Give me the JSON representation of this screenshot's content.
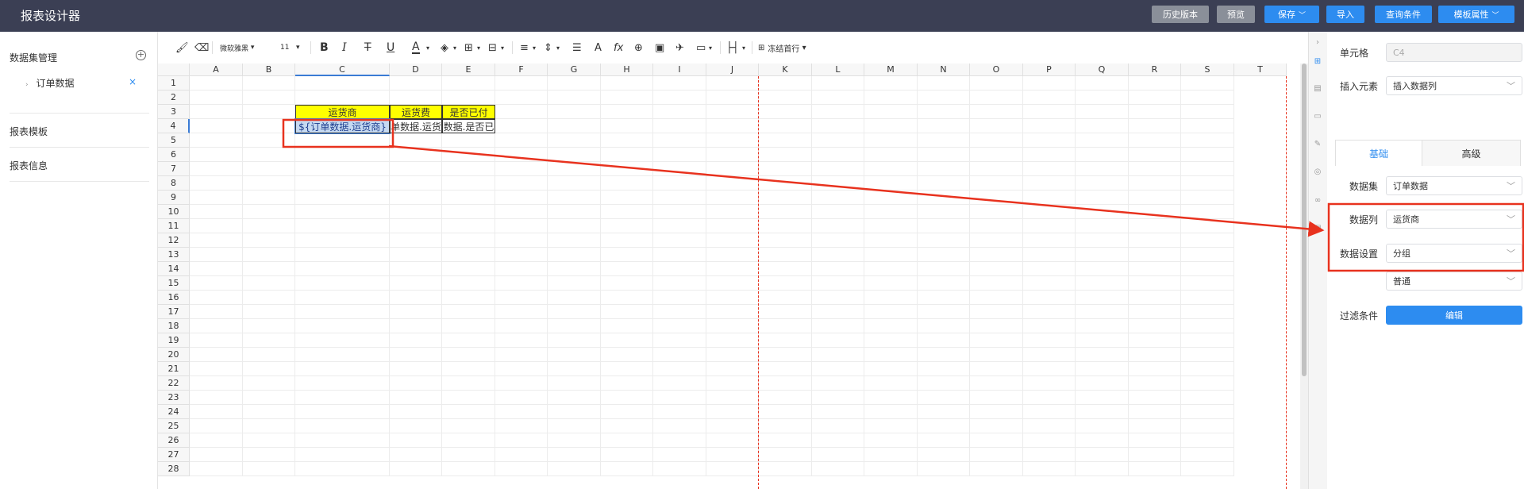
{
  "header": {
    "title": "报表设计器",
    "buttons": {
      "history": "历史版本",
      "preview": "预览",
      "save": "保存",
      "import": "导入",
      "query": "查询条件",
      "template_props": "模板属性"
    }
  },
  "sidebar": {
    "datasets_title": "数据集管理",
    "dataset_item": "订单数据",
    "templates": "报表模板",
    "info": "报表信息"
  },
  "toolbar": {
    "font_family": "微软雅黑",
    "font_size": "11",
    "bold": "B",
    "italic": "I",
    "strike": "T",
    "underline": "U",
    "font_color": "A",
    "fx": "fx",
    "freeze": "冻结首行"
  },
  "grid": {
    "columns": [
      "A",
      "B",
      "C",
      "D",
      "E",
      "F",
      "G",
      "H",
      "I",
      "J",
      "K",
      "L",
      "M",
      "N",
      "O",
      "P",
      "Q",
      "R",
      "S",
      "T"
    ],
    "rows": [
      "1",
      "2",
      "3",
      "4",
      "5",
      "6",
      "7",
      "8",
      "9",
      "10",
      "11",
      "12",
      "13",
      "14",
      "15",
      "16",
      "17",
      "18",
      "19",
      "20",
      "21",
      "22",
      "23",
      "24",
      "25",
      "26",
      "27",
      "28"
    ],
    "cells": {
      "C3": "运货商",
      "D3": "运货费",
      "E3": "是否已付",
      "C4": "${订单数据.运货商}",
      "D4": "单数据.运货",
      "E4": "数据.是否已"
    },
    "highlight_color": "#ffff00",
    "selected_color": "#c5d9f1",
    "annotation_color": "#e8321e"
  },
  "panel": {
    "cell_label": "单元格",
    "cell_value": "C4",
    "insert_label": "插入元素",
    "insert_value": "插入数据列",
    "tab_basic": "基础",
    "tab_advanced": "高级",
    "dataset_label": "数据集",
    "dataset_value": "订单数据",
    "column_label": "数据列",
    "column_value": "运货商",
    "setting_label": "数据设置",
    "setting_value1": "分组",
    "setting_value2": "普通",
    "filter_label": "过滤条件",
    "filter_button": "编辑"
  }
}
